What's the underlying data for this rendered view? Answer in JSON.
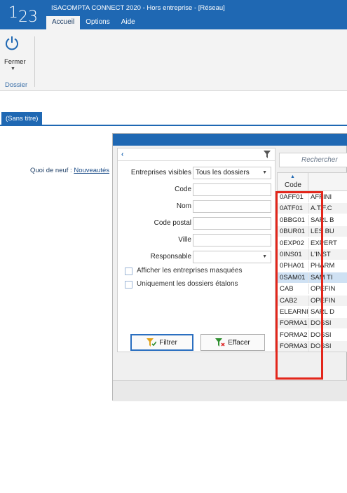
{
  "app": {
    "logo_text_1": "1",
    "logo_text_2": "23",
    "window_title": "ISACOMPTA CONNECT 2020 - Hors entreprise - [Réseau]"
  },
  "menu": {
    "items": [
      {
        "label": "Accueil"
      },
      {
        "label": "Options"
      },
      {
        "label": "Aide"
      }
    ]
  },
  "ribbon": {
    "close_label": "Fermer",
    "group_label": "Dossier",
    "power_icon": "power-icon"
  },
  "tabs": {
    "document_tab": "(Sans titre)"
  },
  "news": {
    "prefix": "Quoi de neuf :",
    "link": "Nouveautés"
  },
  "filter_panel": {
    "collapse_glyph": "‹",
    "filter_icon": "funnel-icon",
    "visible_label": "Entreprises visibles",
    "visible_value": "Tous les dossiers",
    "code_label": "Code",
    "code_value": "",
    "nom_label": "Nom",
    "nom_value": "",
    "cp_label": "Code postal",
    "cp_value": "",
    "ville_label": "Ville",
    "ville_value": "",
    "responsable_label": "Responsable",
    "responsable_value": "",
    "show_hidden_label": "Afficher les entreprises masquées",
    "show_hidden_checked": false,
    "etalons_label": "Uniquement les dossiers étalons",
    "etalons_checked": false,
    "filter_button": "Filtrer",
    "clear_button": "Effacer"
  },
  "grid": {
    "search_placeholder": "Rechercher",
    "sort_arrow": "▲",
    "column_code": "Code",
    "rows": [
      {
        "code": "0AFF01",
        "name": "AFFINI"
      },
      {
        "code": "0ATF01",
        "name": "A.T.F.C"
      },
      {
        "code": "0BBG01",
        "name": "SARL B"
      },
      {
        "code": "0BUR01",
        "name": "LES BU"
      },
      {
        "code": "0EXP02",
        "name": "EXPERT"
      },
      {
        "code": "0INS01",
        "name": "L'INST"
      },
      {
        "code": "0PHA01",
        "name": "PHARM"
      },
      {
        "code": "0SAM01",
        "name": "SAM TI"
      },
      {
        "code": "CAB",
        "name": "OPEFIN"
      },
      {
        "code": "CAB2",
        "name": "OPEFIN"
      },
      {
        "code": "ELEARNI",
        "name": "SARL D"
      },
      {
        "code": "FORMA1",
        "name": "DOSSI"
      },
      {
        "code": "FORMA2",
        "name": "DOSSI"
      },
      {
        "code": "FORMA3",
        "name": "DOSSI"
      }
    ],
    "selected_index": 7
  },
  "colors": {
    "brand_blue": "#1f68b3",
    "highlight_red": "#e3261b",
    "selected_row": "#cfe1f3"
  }
}
